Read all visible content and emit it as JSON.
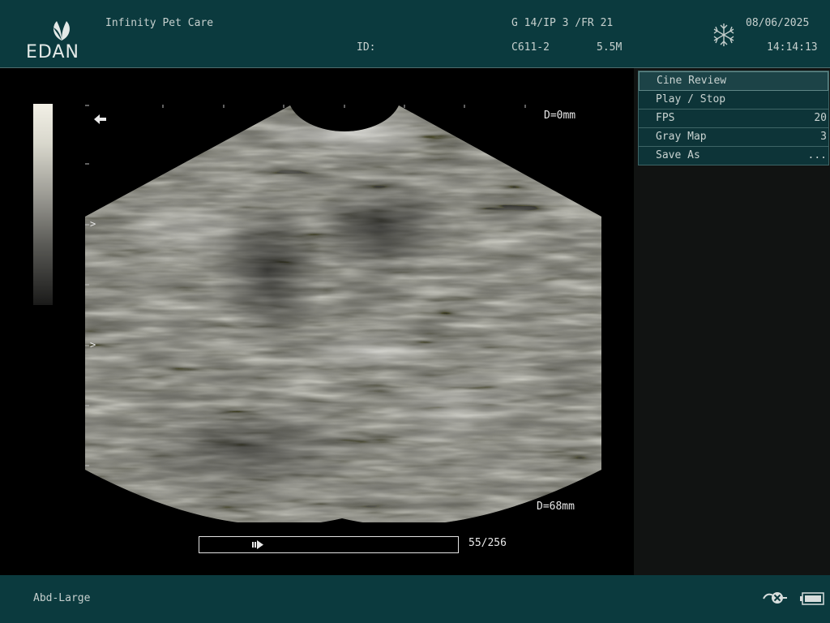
{
  "header": {
    "logo_text": "EDAN",
    "institution": "Infinity Pet Care",
    "id_label": "ID:",
    "gain_params": "G 14/IP 3 /FR 21",
    "probe": "C611-2",
    "frequency": "5.5M",
    "date": "08/06/2025",
    "time": "14:14:13",
    "freeze_icon": "snowflake-icon"
  },
  "image": {
    "depth_top": "D=0mm",
    "depth_bottom": "D=68mm",
    "focus_markers": [
      ">",
      ">"
    ],
    "direction_icon": "left-arrow-icon"
  },
  "menu": {
    "title": "Cine Review",
    "items": [
      {
        "label": "Play / Stop",
        "value": ""
      },
      {
        "label": "FPS",
        "value": "20"
      },
      {
        "label": "Gray Map",
        "value": "3"
      },
      {
        "label": "Save As",
        "value": "..."
      }
    ]
  },
  "cine": {
    "current_frame": 55,
    "total_frames": 256,
    "frame_counter": "55/256"
  },
  "footer": {
    "preset": "Abd-Large",
    "icons": [
      "probe-icon",
      "battery-icon"
    ]
  },
  "colors": {
    "header_bg": "#0b3a3e",
    "menu_bg": "#0d3438",
    "panel_bg": "#111312"
  }
}
